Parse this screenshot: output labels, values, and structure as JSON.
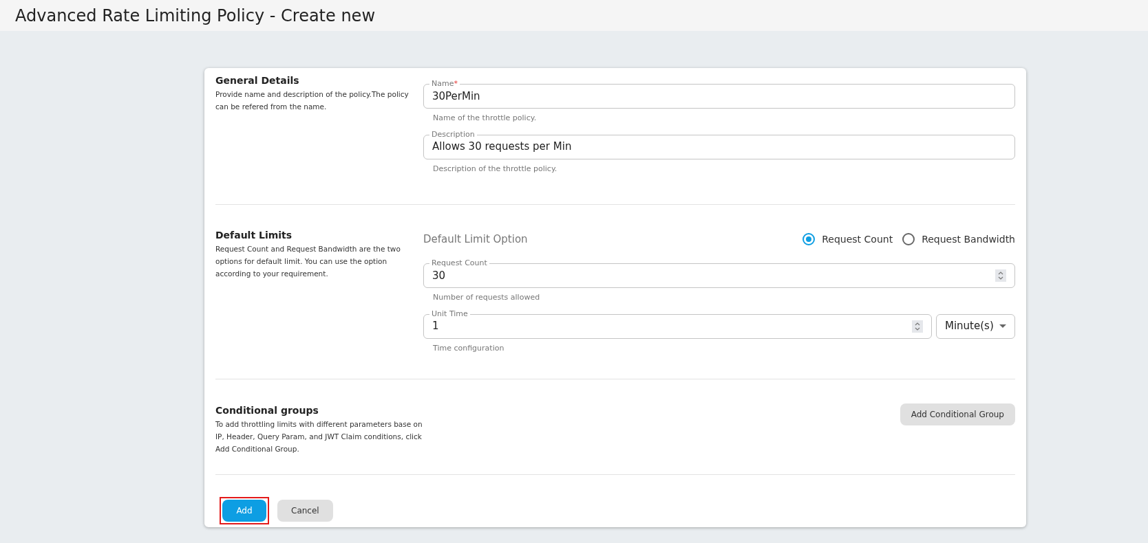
{
  "page_title": "Advanced Rate Limiting Policy - Create new",
  "sections": [
    {
      "kind": "fields",
      "title": "General Details",
      "description": "Provide name and description of the policy.The policy can be refered from the name.",
      "fields": [
        {
          "kind": "text",
          "label": "Name",
          "required_mark": "*",
          "value": "30PerMin",
          "helper": "Name of the throttle policy."
        },
        {
          "kind": "text",
          "label": "Description",
          "value": "Allows 30 requests per Min",
          "helper": "Description of the throttle policy."
        }
      ]
    },
    {
      "kind": "fields",
      "title": "Default Limits",
      "description": "Request Count and Request Bandwidth are the two options for default limit. You can use the option according to your requirement.",
      "option_label": "Default Limit Option",
      "options": [
        {
          "label": "Request Count",
          "selected": true
        },
        {
          "label": "Request Bandwidth",
          "selected": false
        }
      ],
      "fields": [
        {
          "kind": "number",
          "label": "Request Count",
          "value": "30",
          "helper": "Number of requests allowed"
        },
        {
          "kind": "number_unit",
          "label": "Unit Time",
          "value": "1",
          "unit": "Minute(s)",
          "helper": "Time configuration"
        }
      ]
    },
    {
      "kind": "action",
      "title": "Conditional groups",
      "description": "To add throttling limits with different parameters base on IP, Header, Query Param, and JWT Claim conditions, click Add Conditional Group.",
      "button": "Add Conditional Group"
    }
  ],
  "buttons": [
    {
      "kind": "primary",
      "label": "Add",
      "highlighted": true
    },
    {
      "kind": "secondary",
      "label": "Cancel",
      "highlighted": false
    }
  ]
}
